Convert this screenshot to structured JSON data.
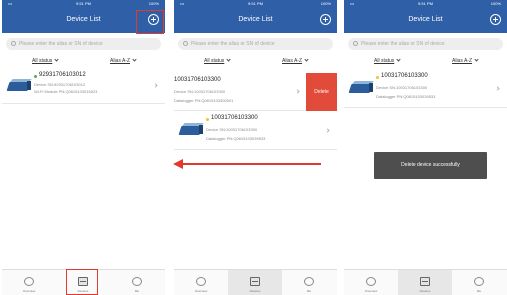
{
  "app": {
    "status_carrier": "•••",
    "status_time": "9:51 PM",
    "status_battery": "100%",
    "title": "Device List",
    "search_placeholder": "Please enter the alias or SN of device",
    "filter_status": "All status",
    "filter_sort": "Alias A-Z",
    "tabs": [
      {
        "label": "Overview",
        "icon": "home-icon"
      },
      {
        "label": "Devices",
        "icon": "device-list-icon"
      },
      {
        "label": "Me",
        "icon": "person-icon"
      }
    ]
  },
  "screen1": {
    "device": {
      "sn": "92931706103012",
      "device_sn": "Device SN:92931706103012",
      "module_pn": "Wi-Fi Module PN:Q0815103016523",
      "status_color": "#4caf50"
    },
    "active_tab": 1
  },
  "screen2": {
    "swiped_device": {
      "sn": "10031706103300",
      "device_sn": "Device SN:10031706103300",
      "datalogger_pn": "Datalogger PN:Q0815103300001"
    },
    "delete_label": "Delete",
    "device": {
      "sn": "10031706103300",
      "device_sn": "Device SN:10031706103300",
      "datalogger_pn": "Datalogger PN:Q0815103039533",
      "status_color": "#f2c230"
    },
    "active_tab": 1
  },
  "screen3": {
    "device": {
      "sn": "10031706103300",
      "device_sn": "Device SN:10031706103300",
      "datalogger_pn": "Datalogger PN:Q0815103039533",
      "status_color": "#f2c230"
    },
    "toast": "Delete device successfully",
    "active_tab": 1
  },
  "colors": {
    "header": "#2f5fa7",
    "delete": "#e24a3a",
    "annotation": "#e03a2f"
  }
}
